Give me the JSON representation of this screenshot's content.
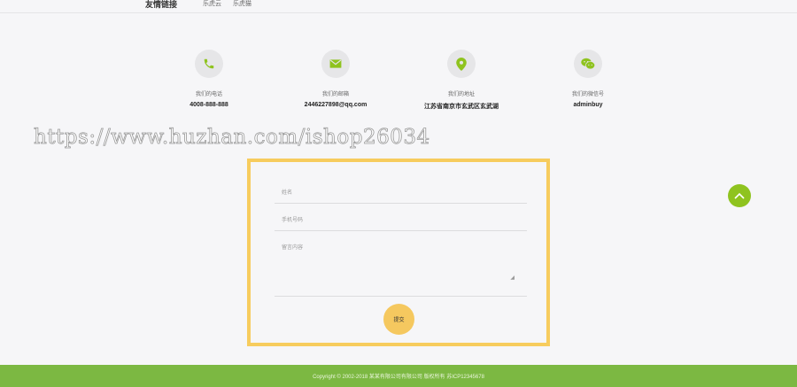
{
  "friend_links": {
    "title": "友情链接",
    "items": [
      "乐虎云",
      "乐虎猫"
    ]
  },
  "contacts": [
    {
      "icon": "phone-icon",
      "label": "我们的电话",
      "value": "4008-888-888"
    },
    {
      "icon": "mail-icon",
      "label": "我们的邮箱",
      "value": "2446227898@qq.com"
    },
    {
      "icon": "location-pin-icon",
      "label": "我们的地址",
      "value": "江苏省南京市玄武区玄武湖"
    },
    {
      "icon": "wechat-icon",
      "label": "我们的微信号",
      "value": "adminbuy"
    }
  ],
  "watermark": "https://www.huzhan.com/ishop26034",
  "form": {
    "name_placeholder": "姓名",
    "phone_placeholder": "手机号码",
    "message_placeholder": "留言内容",
    "submit_label": "提交"
  },
  "footer": {
    "copyright": "Copyright © 2002-2018 某某有限公司有限公司 版权所有 苏ICP12345678"
  },
  "colors": {
    "accent_green": "#8fc31f",
    "form_border": "#f7cc5e",
    "submit_bg": "#f5c85f",
    "footer_bg": "#7cb842"
  }
}
